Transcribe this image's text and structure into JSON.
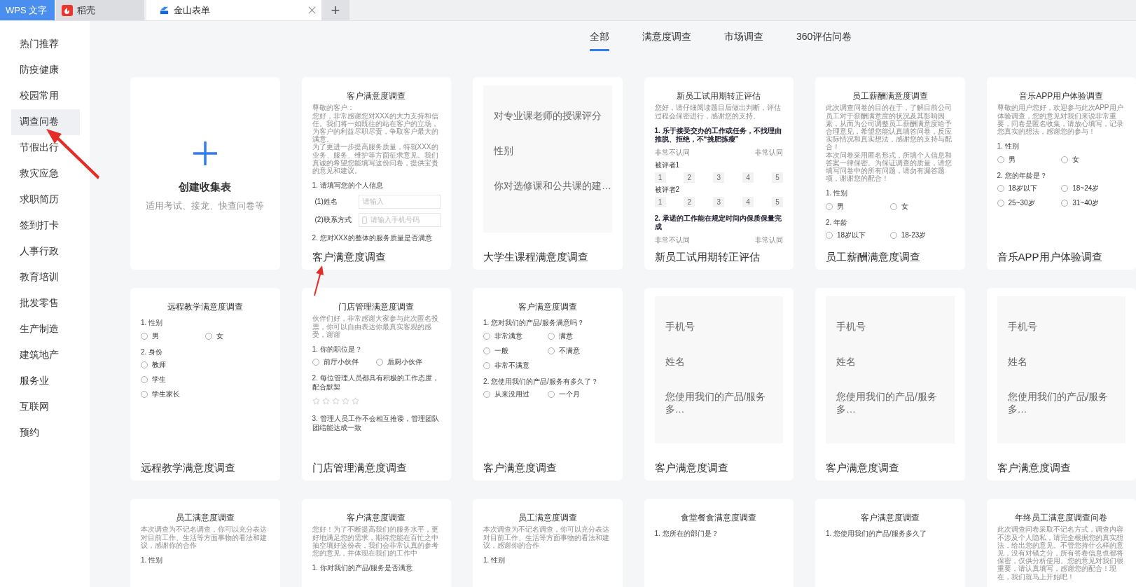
{
  "app_tabs": [
    {
      "label": "WPS 文字",
      "kind": "brand",
      "selected": false,
      "closable": false
    },
    {
      "label": "稻壳",
      "kind": "docer",
      "selected": false,
      "closable": false
    },
    {
      "label": "金山表单",
      "kind": "form",
      "selected": true,
      "closable": true
    }
  ],
  "new_tab_button": "+",
  "sidebar": {
    "items": [
      {
        "label": "热门推荐",
        "selected": false
      },
      {
        "label": "防疫健康",
        "selected": false
      },
      {
        "label": "校园常用",
        "selected": false
      },
      {
        "label": "调查问卷",
        "selected": true
      },
      {
        "label": "节假出行",
        "selected": false
      },
      {
        "label": "救灾应急",
        "selected": false
      },
      {
        "label": "求职简历",
        "selected": false
      },
      {
        "label": "签到打卡",
        "selected": false
      },
      {
        "label": "人事行政",
        "selected": false
      },
      {
        "label": "教育培训",
        "selected": false
      },
      {
        "label": "批发零售",
        "selected": false
      },
      {
        "label": "生产制造",
        "selected": false
      },
      {
        "label": "建筑地产",
        "selected": false
      },
      {
        "label": "服务业",
        "selected": false
      },
      {
        "label": "互联网",
        "selected": false
      },
      {
        "label": "预约",
        "selected": false
      }
    ]
  },
  "categories": [
    {
      "label": "全部",
      "selected": true
    },
    {
      "label": "满意度调查",
      "selected": false
    },
    {
      "label": "市场调查",
      "selected": false
    },
    {
      "label": "360评估问卷",
      "selected": false
    }
  ],
  "cards": [
    {
      "kind": "create",
      "title": "创建收集表",
      "subtitle": "适用考试、接龙、快查问卷等"
    },
    {
      "kind": "form",
      "title": "客户满意度调查",
      "preview": {
        "heading": "客户满意度调查",
        "intro": [
          "尊敬的客户：",
          "您好，非常感谢您对XXX的大力支持和信任。我们将一如既往的站在客户的立场，为客户的利益尽职尽责，争取客户最大的满意。",
          "为了更进一步提高服务质量，特就XXX的业务、服务、维护等方面征求意见。我们真诚的希望您能填写这份问卷，提供宝贵的意见和建议。"
        ],
        "blocks": [
          {
            "kind": "question",
            "bold": false,
            "text": "1. 请填写您的个人信息"
          },
          {
            "kind": "input",
            "label": "(1)姓名",
            "placeholder": "请输入"
          },
          {
            "kind": "phone-input",
            "label": "(2)联系方式",
            "placeholder": "请输入手机号码"
          },
          {
            "kind": "question",
            "bold": false,
            "text": "2. 您对XXX的整体的服务质量是否满意"
          }
        ]
      }
    },
    {
      "kind": "fields",
      "title": "大学生课程满意度调查",
      "fields": [
        "对专业课老师的授课评分",
        "性别",
        "你对选修课和公共课的建…"
      ]
    },
    {
      "kind": "form",
      "title": "新员工试用期转正评估",
      "preview": {
        "heading": "新员工试用期转正评估",
        "intro": [
          "您好，请仔细阅读题目后做出判断，评估过程会保密进行，感谢您的支持。"
        ],
        "blocks": [
          {
            "kind": "question",
            "bold": true,
            "text": "1. 乐于接受交办的工作或任务，不找理由推脱、拒绝，不“挑肥拣瘦”"
          },
          {
            "kind": "scale",
            "low": "非常不认同",
            "high": "非常认同"
          },
          {
            "kind": "rater",
            "label": "被评者1",
            "values": [
              "1",
              "2",
              "3",
              "4",
              "5"
            ]
          },
          {
            "kind": "rater",
            "label": "被评者2",
            "values": [
              "1",
              "2",
              "3",
              "4",
              "5"
            ]
          },
          {
            "kind": "question",
            "bold": true,
            "text": "2. 承诺的工作能在规定时间内保质保量完成"
          },
          {
            "kind": "scale",
            "low": "非常不认同",
            "high": "非常认同"
          }
        ]
      }
    },
    {
      "kind": "form",
      "title": "员工薪酬满意度调查",
      "preview": {
        "heading": "员工薪酬满意度调查",
        "intro": [
          "此次调查问卷的目的在于，了解目前公司员工对于薪酬满意度的状况及其影响因素，从而为公司调整员工薪酬满意度给予合理意见，希望您能认真填答问卷，反应实际情况和真实想法，感谢您的支持与配合！",
          "本次问卷采用匿名形式，所填个人信息和答案一律保密。为保证调查的质量，请您填写问卷中的所有问题，请勿有漏答题项，谢谢您的配合！"
        ],
        "blocks": [
          {
            "kind": "question",
            "bold": false,
            "text": "1. 性别"
          },
          {
            "kind": "options",
            "options": [
              {
                "label": "男",
                "checked": false
              },
              {
                "label": "女",
                "checked": false
              }
            ]
          },
          {
            "kind": "question",
            "bold": false,
            "text": "2. 年龄"
          },
          {
            "kind": "options",
            "options": [
              {
                "label": "18岁以下",
                "checked": false
              },
              {
                "label": "18-23岁",
                "checked": false
              }
            ]
          }
        ]
      }
    },
    {
      "kind": "form",
      "title": "音乐APP用户体验调查",
      "preview": {
        "heading": "音乐APP用户体验调查",
        "intro": [
          "尊敬的用户您好，欢迎参与此次APP用户体验调查，您的意见对我们来说非常重要，问卷是匿名收集，请放心填写，记录您真实的想法，感谢您的参与！"
        ],
        "blocks": [
          {
            "kind": "question",
            "bold": false,
            "text": "1. 性别"
          },
          {
            "kind": "options",
            "options": [
              {
                "label": "男",
                "checked": false
              },
              {
                "label": "女",
                "checked": false
              }
            ]
          },
          {
            "kind": "question",
            "bold": false,
            "text": "2. 您的年龄是？"
          },
          {
            "kind": "options",
            "options": [
              {
                "label": "18岁以下",
                "checked": false
              },
              {
                "label": "18~24岁",
                "checked": false
              },
              {
                "label": "25~30岁",
                "checked": false
              },
              {
                "label": "31~40岁",
                "checked": false
              }
            ]
          }
        ]
      }
    },
    {
      "kind": "form",
      "title": "远程教学满意度调查",
      "preview": {
        "heading": "远程教学满意度调查",
        "blocks": [
          {
            "kind": "question",
            "bold": false,
            "text": "1. 性别"
          },
          {
            "kind": "options",
            "options": [
              {
                "label": "男",
                "checked": false
              },
              {
                "label": "女",
                "checked": false
              }
            ]
          },
          {
            "kind": "question",
            "bold": false,
            "text": "2. 身份"
          },
          {
            "kind": "option-list",
            "options": [
              {
                "label": "教师",
                "checked": false
              },
              {
                "label": "学生",
                "checked": false
              },
              {
                "label": "学生家长",
                "checked": false
              }
            ]
          }
        ]
      }
    },
    {
      "kind": "form",
      "title": "门店管理满意度调查",
      "preview": {
        "heading": "门店管理满意度调查",
        "intro": [
          "伙伴们好，非常感谢大家参与此次匿名投票，你可以自由表达你最真实客观的感受，谢谢"
        ],
        "blocks": [
          {
            "kind": "question",
            "bold": false,
            "text": "1. 你的职位是？"
          },
          {
            "kind": "options",
            "options": [
              {
                "label": "前厅小伙伴",
                "checked": false
              },
              {
                "label": "后厨小伙伴",
                "checked": false
              }
            ]
          },
          {
            "kind": "question",
            "bold": false,
            "text": "2. 每位管理人员都具有积极的工作态度，配合默契"
          },
          {
            "kind": "stars",
            "stars": 0
          },
          {
            "kind": "question",
            "bold": false,
            "text": "3. 管理人员工作不会相互推诿，管理团队团结能达成一致"
          }
        ]
      }
    },
    {
      "kind": "form",
      "title": "客户满意度调查",
      "preview": {
        "heading": "客户满意度调查",
        "blocks": [
          {
            "kind": "question",
            "bold": false,
            "text": "1. 您对我们的产品/服务满意吗？"
          },
          {
            "kind": "options",
            "options": [
              {
                "label": "非常满意",
                "checked": false
              },
              {
                "label": "满意",
                "checked": false
              },
              {
                "label": "一般",
                "checked": false
              },
              {
                "label": "不满意",
                "checked": false
              },
              {
                "label": "非常不满意",
                "checked": false
              }
            ]
          },
          {
            "kind": "question",
            "bold": false,
            "text": "2. 您使用我们的产品/服务有多久了？"
          },
          {
            "kind": "options",
            "options": [
              {
                "label": "从来没用过",
                "checked": false
              },
              {
                "label": "一个月",
                "checked": false
              }
            ]
          }
        ]
      }
    },
    {
      "kind": "fields",
      "title": "客户满意度调查",
      "fields": [
        "手机号",
        "姓名",
        "您使用我们的产品/服务多…"
      ]
    },
    {
      "kind": "fields",
      "title": "客户满意度调查",
      "fields": [
        "手机号",
        "姓名",
        "您使用我们的产品/服务多…"
      ]
    },
    {
      "kind": "fields",
      "title": "客户满意度调查",
      "fields": [
        "手机号",
        "姓名",
        "您使用我们的产品/服务多…"
      ]
    },
    {
      "kind": "form",
      "preview": {
        "heading": "员工满意度调查",
        "intro": [
          "本次调查为不记名调查，你可以充分表达对目前工作、生活等方面事物的看法和建议，感谢你的合作"
        ],
        "blocks": [
          {
            "kind": "question",
            "bold": false,
            "text": "1. 性别"
          }
        ]
      }
    },
    {
      "kind": "form",
      "preview": {
        "heading": "客户满意度调查",
        "intro": [
          "您好！为了不断提高我们的服务水平，更好地满足您的需求，期待您能在百忙之中抽空填好这份表，我们会非常认真的参考您的意见，并体现在我们的工作中"
        ],
        "blocks": [
          {
            "kind": "question",
            "bold": false,
            "text": "1. 你对我们的产品/服务是否满意"
          }
        ]
      }
    },
    {
      "kind": "form",
      "preview": {
        "heading": "员工满意度调查",
        "intro": [
          "本次调查为不记名调查，你可以充分表达对目前工作、生活等方面事物的看法和建议，感谢你的合作"
        ],
        "blocks": [
          {
            "kind": "question",
            "bold": false,
            "text": "1. 性别"
          }
        ]
      }
    },
    {
      "kind": "form",
      "preview": {
        "heading": "食堂餐食满意度调查",
        "blocks": [
          {
            "kind": "question",
            "bold": false,
            "text": "1. 您所在的部门是？"
          }
        ]
      }
    },
    {
      "kind": "form",
      "preview": {
        "heading": "客户满意度调查",
        "blocks": [
          {
            "kind": "question",
            "bold": false,
            "text": "1. 您使用我们的产品/服务多久了"
          }
        ]
      }
    },
    {
      "kind": "form",
      "preview": {
        "heading": "年终员工满意度调查问卷",
        "intro": [
          "此次调查问卷采取不记名方式，调查内容不涉及个人隐私，请完全根据您的真实想法，给出您的意见。不管您持什么样的意见，没有对错之分，所有答卷信息也都将保密，仅供分析使用。您的意见对我们很重要，请认真填写，感谢您的配合！现在，我们就马上开始吧！"
        ]
      }
    }
  ]
}
